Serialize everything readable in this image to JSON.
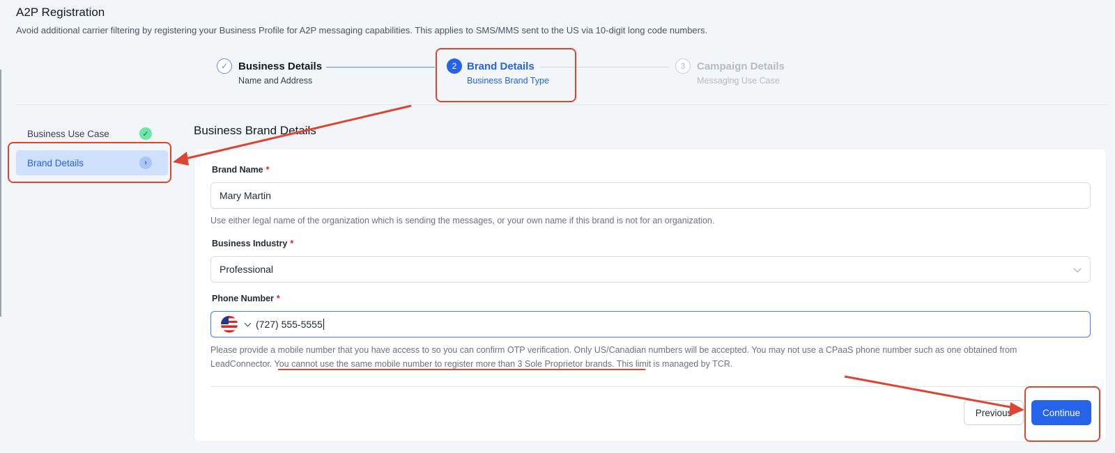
{
  "page": {
    "title": "A2P Registration",
    "subtitle": "Avoid additional carrier filtering by registering your Business Profile for A2P messaging capabilities. This applies to SMS/MMS sent to the US via 10-digit long code numbers."
  },
  "stepper": {
    "steps": [
      {
        "icon": "✓",
        "title": "Business Details",
        "subtitle": "Name and Address",
        "state": "completed"
      },
      {
        "icon": "2",
        "title": "Brand Details",
        "subtitle": "Business Brand Type",
        "state": "active"
      },
      {
        "icon": "3",
        "title": "Campaign Details",
        "subtitle": "Messaging Use Case",
        "state": "upcoming"
      }
    ]
  },
  "sidebar": {
    "items": [
      {
        "label": "Business Use Case",
        "badge": "✓",
        "state": "done"
      },
      {
        "label": "Brand Details",
        "badge": "›",
        "state": "active"
      }
    ]
  },
  "main": {
    "section_title": "Business Brand Details",
    "brand_name": {
      "label": "Brand Name",
      "required_mark": "*",
      "value": "Mary Martin",
      "help": "Use either legal name of the organization which is sending the messages, or your own name if this brand is not for an organization."
    },
    "business_industry": {
      "label": "Business Industry",
      "required_mark": "*",
      "value": "Professional"
    },
    "phone_number": {
      "label": "Phone Number",
      "required_mark": "*",
      "country_flag": "us-flag-icon",
      "value": "(727) 555-5555",
      "help_part1": "Please provide a mobile number that you have access to so you can confirm OTP verification. Only US/Canadian numbers will be accepted. You may not use a CPaaS phone number such as one obtained from",
      "help_part2": "LeadConnector.",
      "help_underlined": "You cannot use the same mobile number to register more than 3 Sole Proprietor brands.",
      "help_part3": "This limit is managed by TCR."
    },
    "buttons": {
      "previous": "Previous",
      "continue": "Continue"
    }
  },
  "colors": {
    "accent": "#2563eb",
    "annotation": "#dc4531",
    "required": "#dc2626"
  }
}
